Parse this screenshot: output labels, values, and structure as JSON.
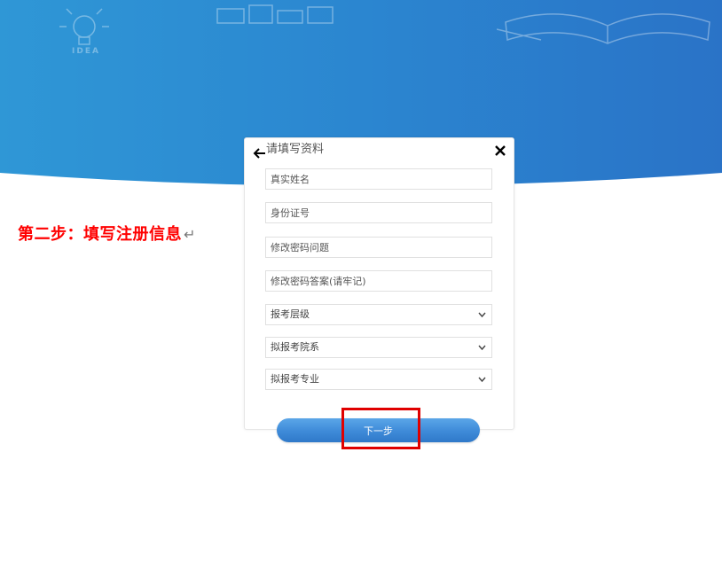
{
  "hero": {
    "badge_text": "IDEA",
    "colors": {
      "top": "#2f97d6",
      "bottom": "#2a73c7"
    }
  },
  "annotation": {
    "step_text": "第二步：填写注册信息",
    "return_mark": "↵",
    "color": "#ff0000"
  },
  "form": {
    "title": "请填写资料",
    "fields": [
      {
        "placeholder": "真实姓名"
      },
      {
        "placeholder": "身份证号"
      },
      {
        "placeholder": "修改密码问题"
      },
      {
        "placeholder": "修改密码答案(请牢记)"
      }
    ],
    "selects": [
      {
        "value": "报考层级"
      },
      {
        "value": "拟报考院系"
      },
      {
        "value": "拟报考专业"
      }
    ],
    "next_button": "下一步"
  },
  "icons": {
    "back": "arrow-left-icon",
    "close": "close-icon",
    "chevron": "chevron-down-icon"
  }
}
